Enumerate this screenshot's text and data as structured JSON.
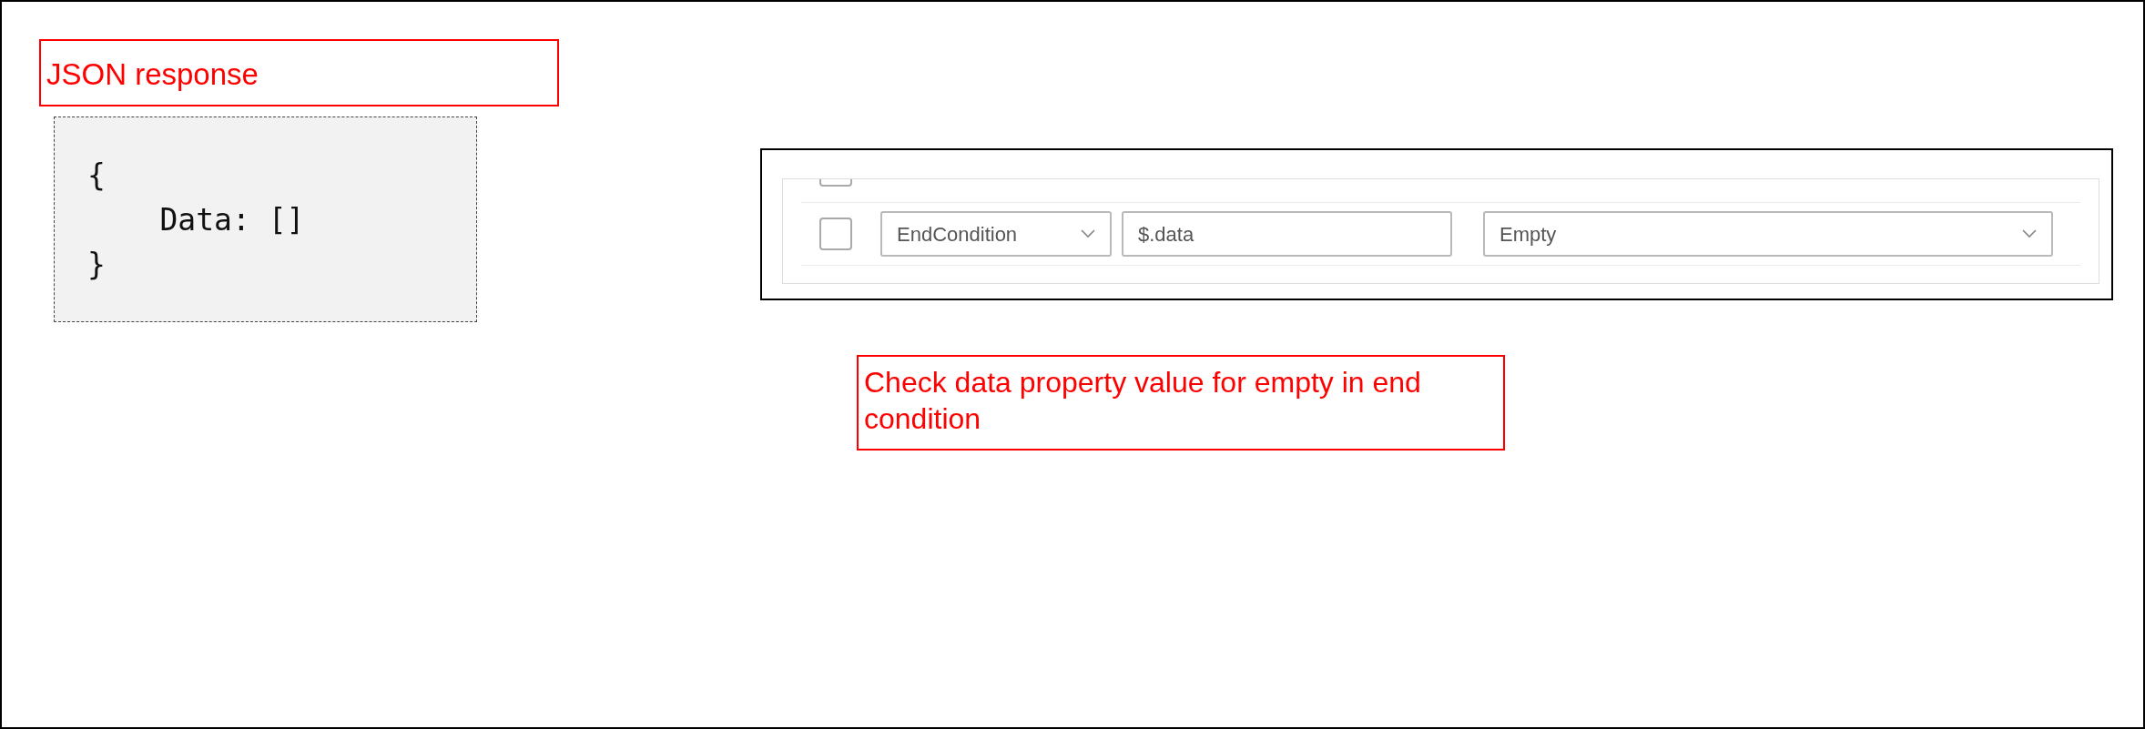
{
  "title_note": "JSON response",
  "code_sample": {
    "lines": [
      "{",
      "    Data: []",
      "}"
    ]
  },
  "previous_row": {
    "checked": false
  },
  "condition_row": {
    "checked": false,
    "field": "EndCondition",
    "path": "$.data",
    "operator": "Empty"
  },
  "caption_note": "Check data property value for empty in end condition"
}
